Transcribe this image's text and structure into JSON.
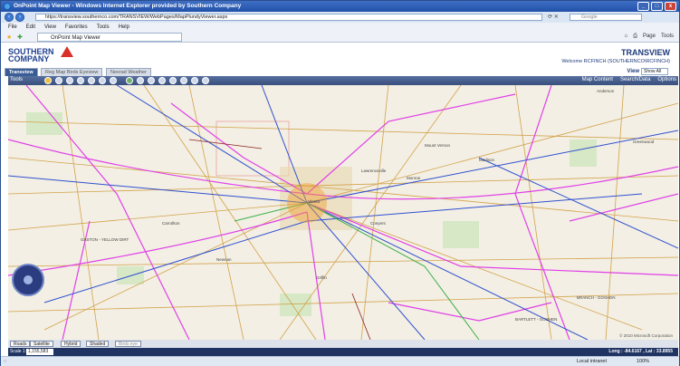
{
  "window": {
    "title": "OnPoint Map Viewer - Windows Internet Explorer provided by Southern Company",
    "controls": [
      "_",
      "□",
      "x"
    ]
  },
  "browser": {
    "url": "https://transview.southernco.com/TRANSVIEW/WebPages/MapPlundyViewer.aspx",
    "search_placeholder": "Google",
    "menu": [
      "File",
      "Edit",
      "View",
      "Favorites",
      "Tools",
      "Help"
    ],
    "tab_title": "OnPoint Map Viewer",
    "tool_items": [
      "Page",
      "Tools"
    ],
    "status": {
      "zone": "Local intranet",
      "zoom": "100%"
    }
  },
  "header": {
    "logo_line1": "SOUTHERN",
    "logo_line2": "COMPANY",
    "app_name": "TRANSVIEW",
    "welcome": "Welcome RCFINCH (SOUTHERNCO\\RCFINCH)"
  },
  "tabs": [
    {
      "label": "Transview",
      "active": true
    },
    {
      "label": "Reg Map Birds Eyeview",
      "active": false
    },
    {
      "label": "Nexrad Weather",
      "active": false
    }
  ],
  "view": {
    "label": "View",
    "selected": "Show All"
  },
  "toolbar": {
    "tools_label": "Tools",
    "right_buttons": [
      "Map Content",
      "Search/Data",
      "Options"
    ]
  },
  "map": {
    "labels": [
      "Anderson",
      "Greenwood",
      "Madison",
      "Monroe",
      "Mount Vernon",
      "GASTON - YELLOW DIRT",
      "BRANCH - GOSHEN",
      "BARTLETT - GOSHEN",
      "Lawrenceville",
      "Conyers",
      "Atlanta",
      "Griffin",
      "Newnan",
      "Carrollton"
    ],
    "copyright": "© 2010 Microsoft Corporation"
  },
  "map_types": [
    "Roads",
    "Satellite",
    "Hybrid",
    "Shaded",
    "Birds eye"
  ],
  "statusbar": {
    "scale_label": "Scale 1:",
    "scale_value": "1,155,583",
    "coords": "Long : -84.6167 , Lat : 33.8955"
  }
}
